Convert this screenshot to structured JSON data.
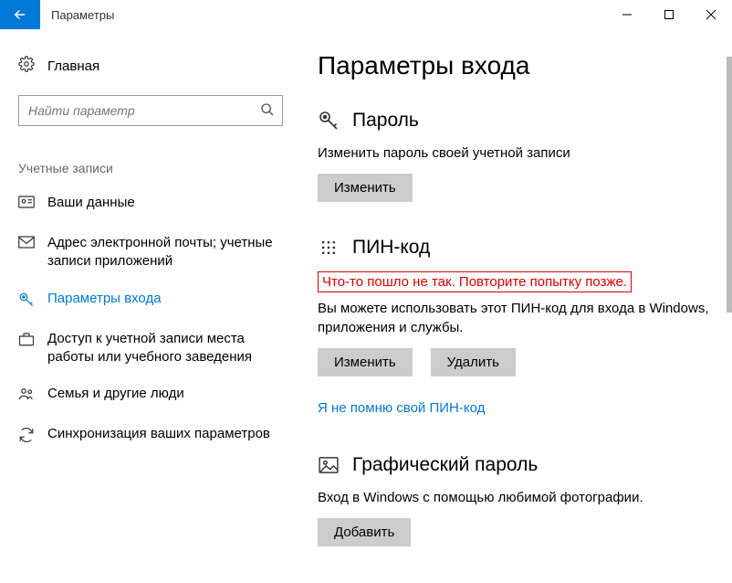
{
  "window": {
    "title": "Параметры"
  },
  "sidebar": {
    "home": "Главная",
    "search_placeholder": "Найти параметр",
    "category": "Учетные записи",
    "items": [
      {
        "label": "Ваши данные"
      },
      {
        "label": "Адрес электронной почты; учетные записи приложений"
      },
      {
        "label": "Параметры входа"
      },
      {
        "label": "Доступ к учетной записи места работы или учебного заведения"
      },
      {
        "label": "Семья и другие люди"
      },
      {
        "label": "Синхронизация ваших параметров"
      }
    ]
  },
  "main": {
    "heading": "Параметры входа",
    "password": {
      "title": "Пароль",
      "desc": "Изменить пароль своей учетной записи",
      "change_btn": "Изменить"
    },
    "pin": {
      "title": "ПИН-код",
      "error": "Что-то пошло не так. Повторите попытку позже.",
      "desc": "Вы можете использовать этот ПИН-код для входа в Windows, приложения и службы.",
      "change_btn": "Изменить",
      "delete_btn": "Удалить",
      "forgot_link": "Я не помню свой ПИН-код"
    },
    "picture": {
      "title": "Графический пароль",
      "desc": "Вход в Windows с помощью любимой фотографии.",
      "add_btn": "Добавить"
    }
  }
}
